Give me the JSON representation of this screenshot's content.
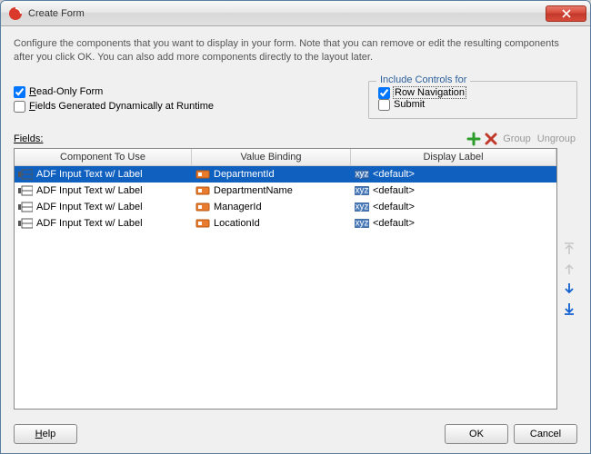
{
  "title": "Create Form",
  "description": "Configure the components that you want to display in your form. Note that you can remove or edit the resulting components after you click OK. You can also add more components directly to the layout later.",
  "leftOptions": {
    "readOnly": {
      "label": "Read-Only Form",
      "checked": true,
      "hotkey": "R"
    },
    "dynamic": {
      "label": "Fields Generated Dynamically at Runtime",
      "checked": false,
      "hotkey": "F"
    }
  },
  "includeControls": {
    "legend": "Include Controls for",
    "rowNav": {
      "label": "Row Navigation",
      "checked": true
    },
    "submit": {
      "label": "Submit",
      "checked": false
    }
  },
  "fieldsLabel": "Fields:",
  "toolbar": {
    "group": "Group",
    "ungroup": "Ungroup"
  },
  "columns": {
    "component": "Component To Use",
    "binding": "Value Binding",
    "label": "Display Label"
  },
  "rows": [
    {
      "component": "ADF Input Text w/ Label",
      "binding": "DepartmentId",
      "label": "<default>",
      "selected": true
    },
    {
      "component": "ADF Input Text w/ Label",
      "binding": "DepartmentName",
      "label": "<default>",
      "selected": false
    },
    {
      "component": "ADF Input Text w/ Label",
      "binding": "ManagerId",
      "label": "<default>",
      "selected": false
    },
    {
      "component": "ADF Input Text w/ Label",
      "binding": "LocationId",
      "label": "<default>",
      "selected": false
    }
  ],
  "buttons": {
    "help": "Help",
    "ok": "OK",
    "cancel": "Cancel"
  }
}
